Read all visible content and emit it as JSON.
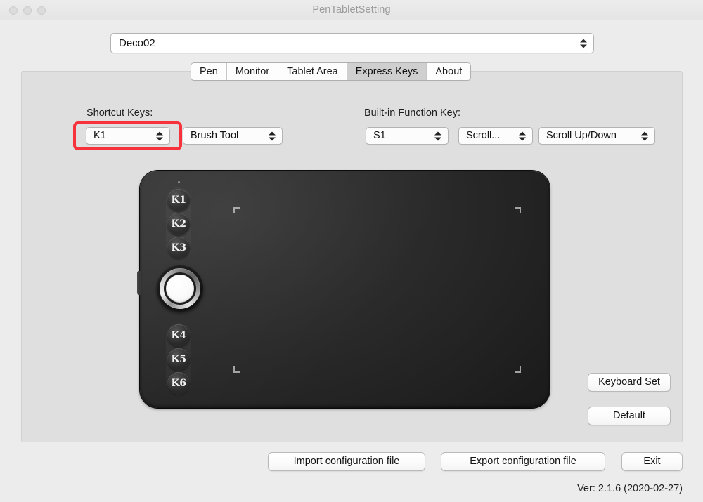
{
  "window": {
    "title": "PenTabletSetting",
    "traffic_lights": [
      "close-button",
      "minimize-button",
      "zoom-button"
    ]
  },
  "device_select": {
    "value": "Deco02",
    "icon": "updown-stepper-icon"
  },
  "tabs": [
    {
      "label": "Pen",
      "active": false
    },
    {
      "label": "Monitor",
      "active": false
    },
    {
      "label": "Tablet Area",
      "active": false
    },
    {
      "label": "Express Keys",
      "active": true
    },
    {
      "label": "About",
      "active": false
    }
  ],
  "shortcut_keys": {
    "label": "Shortcut Keys:",
    "key_select": {
      "value": "K1",
      "highlighted": true
    },
    "action_select": {
      "value": "Brush Tool"
    }
  },
  "builtin_function_key": {
    "label": "Built-in Function Key:",
    "key_select": {
      "value": "S1"
    },
    "mode_select": {
      "value": "Scroll..."
    },
    "action_select": {
      "value": "Scroll Up/Down"
    }
  },
  "tablet": {
    "express_keys_top": [
      "K1",
      "K2",
      "K3"
    ],
    "express_keys_bottom": [
      "K4",
      "K5",
      "K6"
    ],
    "dial": "scroll-dial",
    "led": "status-led",
    "side_button": "side-button"
  },
  "buttons": {
    "keyboard_set": "Keyboard Set",
    "default": "Default",
    "import": "Import configuration file",
    "export": "Export configuration file",
    "exit": "Exit"
  },
  "version": "Ver: 2.1.6 (2020-02-27)",
  "colors": {
    "highlight": "#f8323c",
    "window_bg": "#ececec",
    "panel_bg": "#dfdfdf",
    "tablet_body": "#262626",
    "active_tab_bg": "#cfcfcf"
  }
}
